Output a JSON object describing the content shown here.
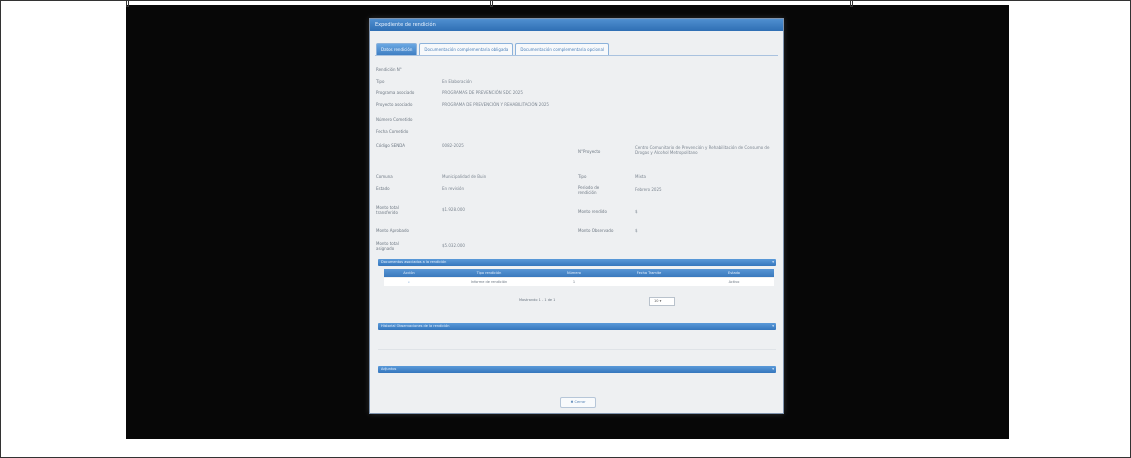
{
  "window": {
    "title": "Expediente de rendición"
  },
  "tabs": [
    {
      "label": "Datos rendición"
    },
    {
      "label": "Documentación complementaria obligada"
    },
    {
      "label": "Documentación complementaria opcional"
    }
  ],
  "fields": {
    "rendicion_no": {
      "label": "Rendición N°",
      "value": ""
    },
    "tipo": {
      "label": "Tipo",
      "value": "En Elaboración"
    },
    "programa": {
      "label": "Programa asociado",
      "value": "PROGRAMAS DE PREVENCIÓN SDC 2025"
    },
    "proyecto": {
      "label": "Proyecto asociado",
      "value": "PROGRAMA DE PREVENCIÓN Y REHABILITACIÓN 2025"
    },
    "numero_cometido": {
      "label": "Número Cometido",
      "value": ""
    },
    "fecha_cometido": {
      "label": "Fecha Cometido",
      "value": ""
    },
    "codigo": {
      "label": "Código SENDA",
      "value": "0082-2025"
    },
    "proyecto_name": {
      "label": "N°Proyecto",
      "value": "Centro Comunitario de Prevención y Rehabilitación de Consumo de Drogas y Alcohol Metropolitano"
    },
    "comuna": {
      "label": "Comuna",
      "value": "Municipalidad de Buin"
    },
    "tipo2": {
      "label": "Tipo",
      "value": "Mixta"
    },
    "estado": {
      "label": "Estado",
      "value": "En revisión"
    },
    "periodo": {
      "label": "Periodo de rendición",
      "value": "Febrero 2025"
    },
    "monto_total": {
      "label": "Monto total transferido",
      "value": "$1.928.000"
    },
    "monto_rendido": {
      "label": "Monto rendido",
      "value": "$"
    },
    "monto_aprobado": {
      "label": "Monto Aprobado",
      "value": ""
    },
    "monto_observado": {
      "label": "Monto Observado",
      "value": "$"
    },
    "monto_asignado": {
      "label": "Monto total asignado",
      "value": "$5.032.000"
    }
  },
  "sections": {
    "documentos": "Documentos asociados a la rendición",
    "observaciones": "Historial Observaciones de la rendición",
    "adjuntos": "Adjuntos"
  },
  "table": {
    "headers": [
      "Acción",
      "Tipo rendición",
      "Número",
      "Fecha Tramite",
      "Estado"
    ],
    "rows": [
      [
        "",
        "Informe de rendición",
        "1",
        "",
        "Activo"
      ]
    ],
    "pager_text": "Mostrando 1 - 1 de 1",
    "page_size": "10"
  },
  "buttons": {
    "close": "Cerrar"
  },
  "icons": {
    "action": "search-icon",
    "close": "close-icon",
    "dropdown": "chevron-down-icon"
  },
  "colors": {
    "header_blue": "#3f7fc3",
    "background": "#070707",
    "panel": "#eef0f2"
  }
}
